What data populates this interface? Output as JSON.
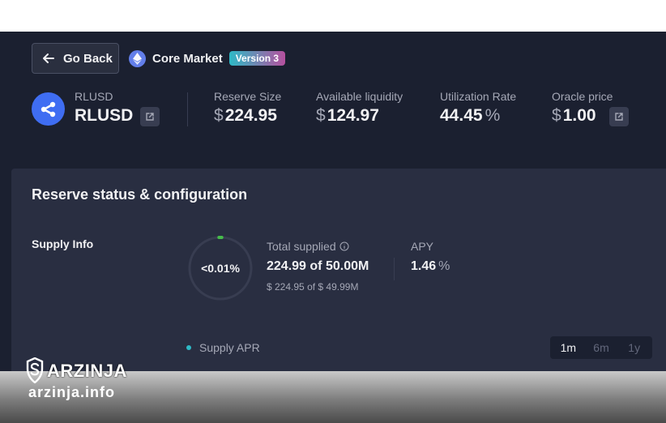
{
  "header": {
    "back_label": "Go Back",
    "market_name": "Core Market",
    "version_badge": "Version 3"
  },
  "asset": {
    "symbol_small": "RLUSD",
    "symbol": "RLUSD"
  },
  "stats": {
    "reserve_size": {
      "label": "Reserve Size",
      "currency": "$",
      "value": "224.95"
    },
    "available_liquidity": {
      "label": "Available liquidity",
      "currency": "$",
      "value": "124.97"
    },
    "utilization_rate": {
      "label": "Utilization Rate",
      "value": "44.45",
      "unit": "%"
    },
    "oracle_price": {
      "label": "Oracle price",
      "currency": "$",
      "value": "1.00"
    }
  },
  "reserve_panel": {
    "title": "Reserve status & configuration",
    "supply_info_label": "Supply Info",
    "supply_ring_text": "<0.01%",
    "supply_ring_fraction": 0.0001,
    "total_supplied_label": "Total supplied",
    "total_supplied_value": "224.99",
    "of_text": "of",
    "supply_cap_value": "50.00M",
    "usd_supplied": "$ 224.95",
    "usd_cap": "$ 49.99M",
    "apy_label": "APY",
    "apy_value": "1.46",
    "apy_unit": "%",
    "legend_label": "Supply APR",
    "ranges": [
      "1m",
      "6m",
      "1y"
    ],
    "active_range": "1m"
  },
  "watermark": {
    "brand": "ARZINJA",
    "url": "arzinja.info"
  },
  "colors": {
    "background": "#1b2030",
    "panel": "#292e41",
    "accent_teal": "#2ebac6",
    "accent_pink": "#b6509e",
    "ring_green": "#46bc4b",
    "eth_blue": "#627eea",
    "asset_blue": "#3f6df2"
  }
}
